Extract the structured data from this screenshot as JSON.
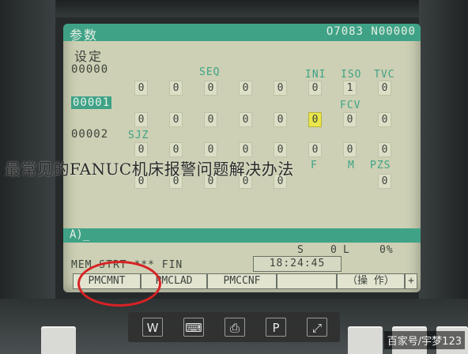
{
  "screen": {
    "title": "参数",
    "program_info": "O7083 N00000",
    "subtitle": "设定"
  },
  "rows": {
    "r0": "00000",
    "r1": "00001",
    "r2": "00002"
  },
  "columns": {
    "seq": "SEQ",
    "ini": "INI",
    "iso": "ISO",
    "tvc": "TVC",
    "fcv": "FCV",
    "sjz": "SJZ",
    "pzs": "PZS",
    "r3_partial_a": "F",
    "r3_partial_b": "M"
  },
  "values": {
    "row0": [
      "0",
      "0",
      "0",
      "0",
      "0",
      "0",
      "1",
      "0"
    ],
    "row1": [
      "0",
      "0",
      "0",
      "0",
      "0",
      "0",
      "0",
      "0"
    ],
    "row2": [
      "0",
      "0",
      "0",
      "0",
      "0",
      "0",
      "0",
      "0"
    ],
    "row3": [
      "0",
      "0",
      "0",
      "0",
      "0",
      "",
      "",
      "0"
    ]
  },
  "input": {
    "prompt": "A)_"
  },
  "status": {
    "s_label": "S",
    "s_value": "0",
    "l_label": "L",
    "percent": "0%",
    "mode": "MEM  STRT  ***  FIN",
    "time": "18:24:45"
  },
  "softkeys": {
    "k1": "PMCMNT",
    "k2": "PMCLAD",
    "k3": "PMCCNF",
    "k4": "",
    "k5": "（操 作）",
    "k6": "+"
  },
  "overlay": {
    "watermark": "最常见的FANUC机床报警问题解决办法",
    "attribution": "百家号/宇梦123"
  },
  "toolbar": {
    "icons": [
      "text-extract-icon",
      "keyboard-icon",
      "print-icon",
      "pdf-icon",
      "expand-icon"
    ]
  },
  "colors": {
    "screen_bg": "#cdd0b4",
    "accent": "#3fa287",
    "highlight_cell": "#e8e64a",
    "circle": "#d72224"
  }
}
